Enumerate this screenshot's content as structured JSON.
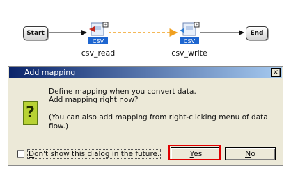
{
  "flow": {
    "start_label": "Start",
    "end_label": "End",
    "tasks": [
      {
        "label": "csv_read",
        "badge": "CSV"
      },
      {
        "label": "csv_write",
        "badge": "CSV"
      }
    ]
  },
  "dialog": {
    "title": "Add mapping",
    "close_glyph": "×",
    "message_line1": "Define mapping when you convert data.",
    "message_line2": "Add mapping right now?",
    "message_note": "(You can also add mapping from right-clicking menu of data\nflow.)",
    "icon_glyph": "?",
    "checkbox_label_mnemonic": "D",
    "checkbox_label_rest": "on't show this dialog in the future.",
    "yes_mnemonic": "Y",
    "yes_rest": "es",
    "no_mnemonic": "N",
    "no_rest": "o"
  },
  "colors": {
    "highlight": "#e00000",
    "title_gradient_start": "#0a246a",
    "title_gradient_end": "#a6caf0",
    "dialog_bg": "#ece9d8"
  }
}
